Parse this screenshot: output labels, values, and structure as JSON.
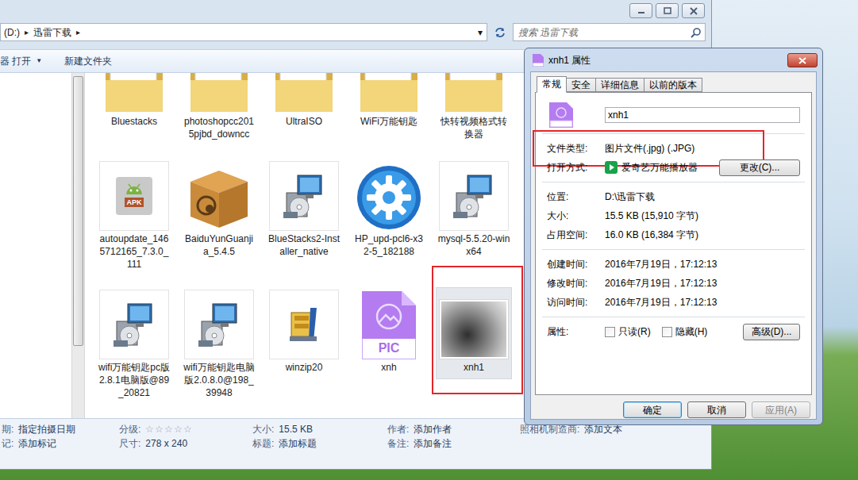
{
  "explorer": {
    "address": {
      "crumbs": [
        "(D:)",
        "迅雷下载"
      ],
      "separator": "▸",
      "dropdown": "▾"
    },
    "search": {
      "placeholder": "搜索 迅雷下载"
    },
    "toolbar": [
      {
        "label": "器 打开",
        "arrow": "▼"
      },
      {
        "label": "新建文件夹",
        "arrow": ""
      }
    ],
    "items": [
      {
        "name": "Bluestacks",
        "kind": "folder",
        "badge": "",
        "selected": false,
        "highlighted": false
      },
      {
        "name": "photoshopcc2015pjbd_downcc",
        "kind": "folder",
        "badge": "",
        "selected": false,
        "highlighted": false
      },
      {
        "name": "UltraISO",
        "kind": "folder",
        "badge": "",
        "selected": false,
        "highlighted": false
      },
      {
        "name": "WiFi万能钥匙",
        "kind": "folder",
        "badge": "",
        "selected": false,
        "highlighted": false
      },
      {
        "name": "快转视频格式转换器",
        "kind": "folder",
        "badge": "",
        "selected": false,
        "highlighted": false
      },
      {
        "name": "autoupdate_1465712165_7.3.0_111",
        "kind": "apk",
        "badge": "APK",
        "selected": false,
        "highlighted": false
      },
      {
        "name": "BaiduYunGuanjia_5.4.5",
        "kind": "box",
        "badge": "",
        "selected": false,
        "highlighted": false
      },
      {
        "name": "BlueStacks2-Installer_native",
        "kind": "installer",
        "badge": "",
        "selected": false,
        "highlighted": false
      },
      {
        "name": "HP_upd-pcl6-x32-5_182188",
        "kind": "gear",
        "badge": "",
        "selected": false,
        "highlighted": false
      },
      {
        "name": "mysql-5.5.20-winx64",
        "kind": "installer",
        "badge": "",
        "selected": false,
        "highlighted": false
      },
      {
        "name": "wifi万能钥匙pc版2.8.1电脑版@89_20821",
        "kind": "installer",
        "badge": "",
        "selected": false,
        "highlighted": false
      },
      {
        "name": "wifi万能钥匙电脑版2.0.8.0@198_39948",
        "kind": "installer",
        "badge": "",
        "selected": false,
        "highlighted": false
      },
      {
        "name": "winzip20",
        "kind": "winzip",
        "badge": "",
        "selected": false,
        "highlighted": false
      },
      {
        "name": "xnh",
        "kind": "pic",
        "badge": "PIC",
        "selected": false,
        "highlighted": false
      },
      {
        "name": "xnh1",
        "kind": "photo",
        "badge": "",
        "selected": true,
        "highlighted": true
      }
    ],
    "details": {
      "columns": [
        [
          {
            "kind": "text",
            "label": "期:",
            "value": "指定拍摄日期",
            "stars": 0,
            "star": ""
          },
          {
            "kind": "text",
            "label": "记:",
            "value": "添加标记",
            "stars": 0,
            "star": ""
          }
        ],
        [
          {
            "kind": "rating",
            "label": "分级:",
            "value": "",
            "stars": 0,
            "star": "☆"
          },
          {
            "kind": "text",
            "label": "尺寸:",
            "value": "278 x 240",
            "stars": 0,
            "star": ""
          }
        ],
        [
          {
            "kind": "text",
            "label": "大小:",
            "value": "15.5 KB",
            "stars": 0,
            "star": ""
          },
          {
            "kind": "text",
            "label": "标题:",
            "value": "添加标题",
            "stars": 0,
            "star": ""
          }
        ],
        [
          {
            "kind": "text",
            "label": "作者:",
            "value": "添加作者",
            "stars": 0,
            "star": ""
          },
          {
            "kind": "text",
            "label": "备注:",
            "value": "添加备注",
            "stars": 0,
            "star": ""
          }
        ],
        [
          {
            "kind": "text",
            "label": "照相机制造商:",
            "value": "添加文本",
            "stars": 0,
            "star": ""
          }
        ]
      ]
    }
  },
  "dialog": {
    "title": "xnh1 属性",
    "tabs": [
      {
        "label": "常规",
        "selected": true
      },
      {
        "label": "安全",
        "selected": false
      },
      {
        "label": "详细信息",
        "selected": false
      },
      {
        "label": "以前的版本",
        "selected": false
      }
    ],
    "name": "xnh1",
    "groups": [
      [
        {
          "kind": "text",
          "label": "文件类型:",
          "value": "图片文件(.jpg) (.JPG)",
          "button": "",
          "highlighted": true,
          "checkboxes": []
        },
        {
          "kind": "app",
          "label": "打开方式:",
          "value": "爱奇艺万能播放器",
          "button": "更改(C)...",
          "highlighted": false,
          "checkboxes": []
        }
      ],
      [
        {
          "kind": "text",
          "label": "位置:",
          "value": "D:\\迅雷下载",
          "button": "",
          "highlighted": false,
          "checkboxes": []
        },
        {
          "kind": "text",
          "label": "大小:",
          "value": "15.5 KB (15,910 字节)",
          "button": "",
          "highlighted": false,
          "checkboxes": []
        },
        {
          "kind": "text",
          "label": "占用空间:",
          "value": "16.0 KB (16,384 字节)",
          "button": "",
          "highlighted": false,
          "checkboxes": []
        }
      ],
      [
        {
          "kind": "text",
          "label": "创建时间:",
          "value": "2016年7月19日，17:12:13",
          "button": "",
          "highlighted": false,
          "checkboxes": []
        },
        {
          "kind": "text",
          "label": "修改时间:",
          "value": "2016年7月19日，17:12:13",
          "button": "",
          "highlighted": false,
          "checkboxes": []
        },
        {
          "kind": "text",
          "label": "访问时间:",
          "value": "2016年7月19日，17:12:13",
          "button": "",
          "highlighted": false,
          "checkboxes": []
        }
      ],
      [
        {
          "kind": "attributes",
          "label": "属性:",
          "value": "",
          "button": "高级(D)...",
          "highlighted": false,
          "checkboxes": [
            {
              "label": "只读(R)",
              "checked": false
            },
            {
              "label": "隐藏(H)",
              "checked": false
            }
          ]
        }
      ]
    ],
    "buttons": [
      {
        "label": "确定",
        "default": true,
        "disabled": false
      },
      {
        "label": "取消",
        "default": false,
        "disabled": false
      },
      {
        "label": "应用(A)",
        "default": false,
        "disabled": true
      }
    ]
  }
}
